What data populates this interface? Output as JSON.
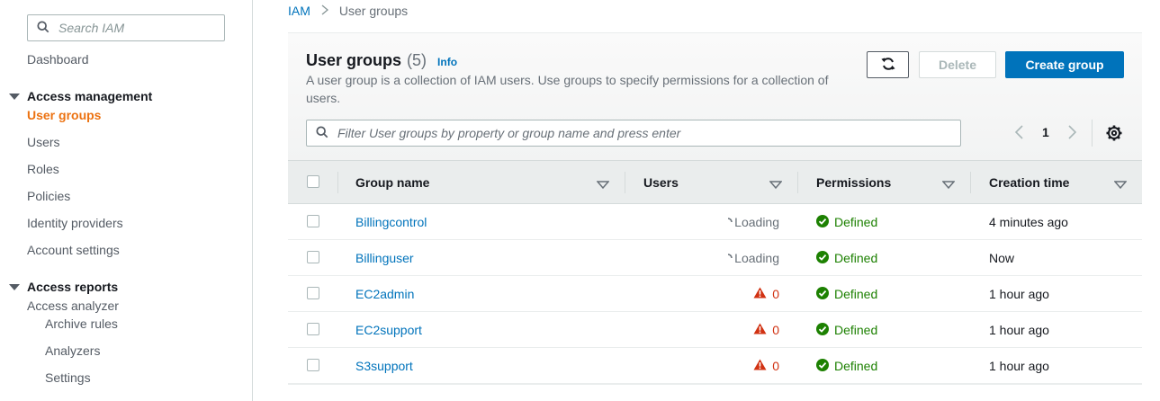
{
  "sidebar": {
    "search_placeholder": "Search IAM",
    "dashboard": "Dashboard",
    "sections": [
      {
        "title": "Access management",
        "items": [
          "User groups",
          "Users",
          "Roles",
          "Policies",
          "Identity providers",
          "Account settings"
        ],
        "active": "User groups"
      },
      {
        "title": "Access reports",
        "items": [
          "Access analyzer"
        ],
        "subitems": [
          "Archive rules",
          "Analyzers",
          "Settings"
        ]
      }
    ],
    "accent_color": "#ec7211"
  },
  "breadcrumb": {
    "items": [
      "IAM",
      "User groups"
    ]
  },
  "panel": {
    "title": "User groups",
    "count": "(5)",
    "info": "Info",
    "description": "A user group is a collection of IAM users. Use groups to specify permissions for a collection of users.",
    "buttons": {
      "refresh_icon": "refresh-icon",
      "delete": "Delete",
      "create": "Create group"
    },
    "filter_placeholder": "Filter User groups by property or group name and press enter",
    "pagination": {
      "current_page": "1"
    }
  },
  "table": {
    "columns": [
      "Group name",
      "Users",
      "Permissions",
      "Creation time"
    ],
    "rows": [
      {
        "name": "Billingcontrol",
        "users": "Loading",
        "users_state": "loading",
        "permissions": "Defined",
        "created": "4 minutes ago"
      },
      {
        "name": "Billinguser",
        "users": "Loading",
        "users_state": "loading",
        "permissions": "Defined",
        "created": "Now"
      },
      {
        "name": "EC2admin",
        "users": "0",
        "users_state": "warning",
        "permissions": "Defined",
        "created": "1 hour ago"
      },
      {
        "name": "EC2support",
        "users": "0",
        "users_state": "warning",
        "permissions": "Defined",
        "created": "1 hour ago"
      },
      {
        "name": "S3support",
        "users": "0",
        "users_state": "warning",
        "permissions": "Defined",
        "created": "1 hour ago"
      }
    ]
  },
  "colors": {
    "link": "#0073bb",
    "primary_button": "#0073bb",
    "success": "#1d8102",
    "warning": "#d13212"
  }
}
